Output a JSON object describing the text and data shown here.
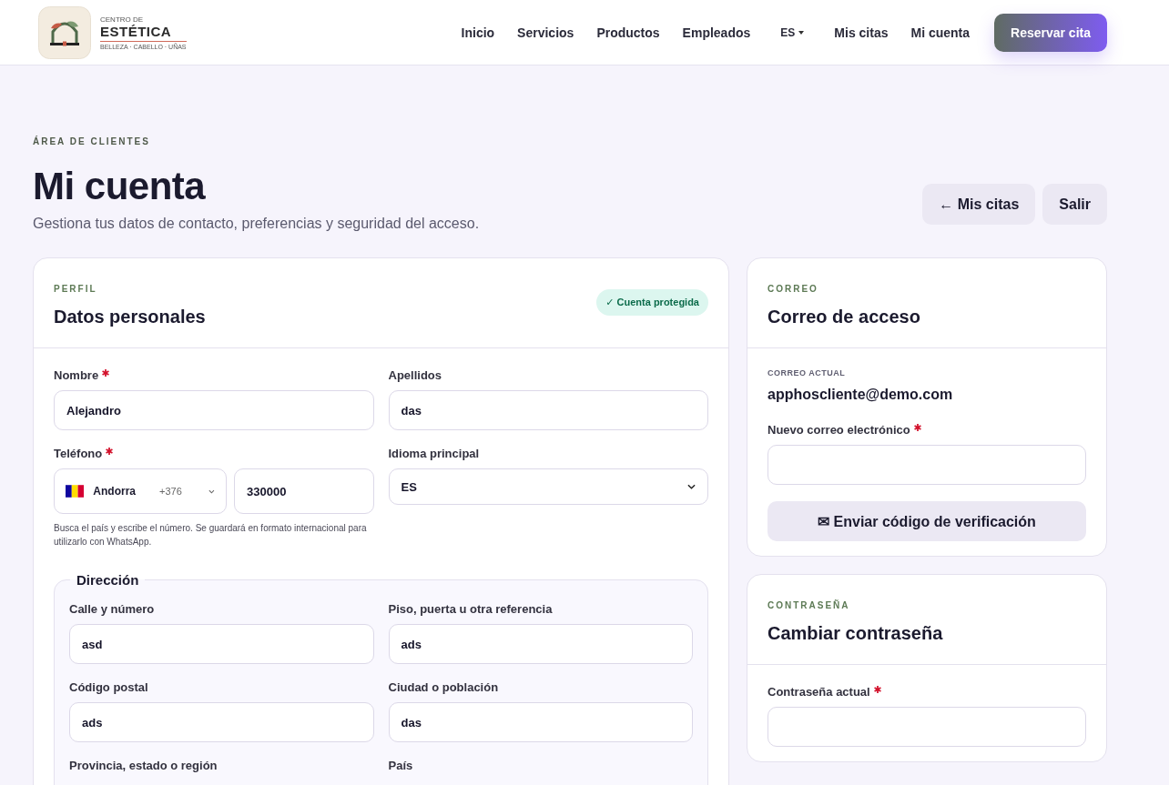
{
  "header": {
    "logo": {
      "top": "CENTRO DE",
      "name": "ESTÉTICA",
      "tagline": "BELLEZA · CABELLO · UÑAS"
    },
    "nav": [
      {
        "label": "Inicio",
        "kind": "link"
      },
      {
        "label": "Servicios",
        "kind": "link"
      },
      {
        "label": "Productos",
        "kind": "link"
      },
      {
        "label": "Empleados",
        "kind": "link"
      },
      {
        "label": "ES",
        "kind": "dropdown"
      },
      {
        "label": "Mis citas",
        "kind": "link"
      },
      {
        "label": "Mi cuenta",
        "kind": "link"
      }
    ],
    "cta": "Reservar cita"
  },
  "page": {
    "eyebrow": "ÁREA DE CLIENTES",
    "title": "Mi cuenta",
    "subtitle": "Gestiona tus datos de contacto, preferencias y seguridad del acceso.",
    "actions": [
      "← Mis citas",
      "Salir"
    ]
  },
  "profile": {
    "eyebrow": "PERFIL",
    "title": "Datos personales",
    "badge": "✓ Cuenta protegida",
    "fields": [
      {
        "kind": "text",
        "label": "Nombre",
        "required": true,
        "value": "Alejandro"
      },
      {
        "kind": "text",
        "label": "Apellidos",
        "required": false,
        "value": "das"
      },
      {
        "kind": "phone",
        "label": "Teléfono",
        "required": true,
        "country": "Andorra",
        "dial": "+376",
        "value": "330000",
        "hint": "Busca el país y escribe el número. Se guardará en formato internacional para utilizarlo con WhatsApp."
      },
      {
        "kind": "select",
        "label": "Idioma principal",
        "required": false,
        "value": "ES"
      }
    ],
    "address": {
      "legend": "Dirección",
      "fields": [
        {
          "kind": "text",
          "label": "Calle y número",
          "required": false,
          "value": "asd"
        },
        {
          "kind": "text",
          "label": "Piso, puerta u otra referencia",
          "required": false,
          "value": "ads"
        },
        {
          "kind": "text",
          "label": "Código postal",
          "required": false,
          "value": "ads"
        },
        {
          "kind": "text",
          "label": "Ciudad o población",
          "required": false,
          "value": "das"
        },
        {
          "kind": "label",
          "label": "Provincia, estado o región",
          "required": false
        },
        {
          "kind": "label",
          "label": "País",
          "required": false
        }
      ]
    }
  },
  "email": {
    "eyebrow": "CORREO",
    "title": "Correo de acceso",
    "current_label": "CORREO ACTUAL",
    "current": "apphoscliente@demo.com",
    "fields": [
      {
        "kind": "text",
        "label": "Nuevo correo electrónico",
        "required": true
      }
    ],
    "button": "✉ Enviar código de verificación"
  },
  "password": {
    "eyebrow": "CONTRASEÑA",
    "title": "Cambiar contraseña",
    "fields": [
      {
        "kind": "text",
        "label": "Contraseña actual",
        "required": true
      }
    ]
  }
}
